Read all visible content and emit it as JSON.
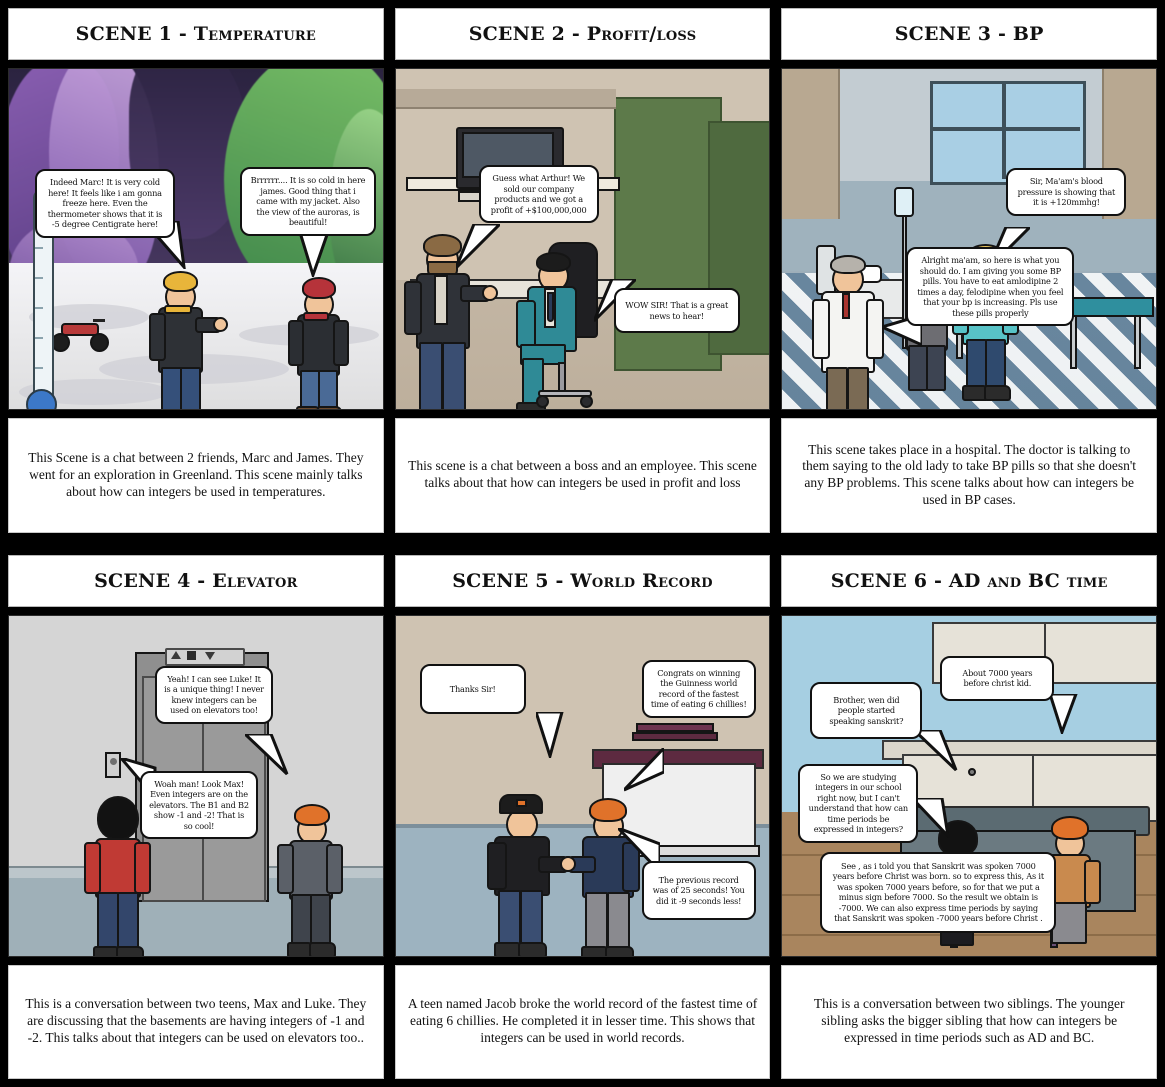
{
  "document": {
    "type": "storyboard",
    "columns": 3,
    "rows": 2,
    "panel_count": 6
  },
  "panels": [
    {
      "id": "scene-1",
      "title": "SCENE 1 - Temperature",
      "setting": "arctic-greenland-aurora",
      "bubbles": [
        {
          "id": "s1-b1",
          "speaker": "James",
          "text": "Indeed Marc! It is very cold here! It feels like i am gonna freeze here. Even the thermometer shows that it is -5 degree Centigrate here!"
        },
        {
          "id": "s1-b2",
          "speaker": "Marc",
          "text": "Brrrrrr.... It is so cold in here james. Good thing that i came with my jacket. Also the view of the auroras, is beautiful!"
        }
      ],
      "caption": "This Scene is a chat between 2 friends, Marc and James. They went for an exploration in Greenland. This scene mainly talks about how can integers be used in temperatures."
    },
    {
      "id": "scene-2",
      "title": "SCENE 2 - Profit/loss",
      "setting": "office-cubicle",
      "bubbles": [
        {
          "id": "s2-b1",
          "speaker": "Boss",
          "text": "Guess what Arthur! We sold our company products and we got a profit of +$100,000,000"
        },
        {
          "id": "s2-b2",
          "speaker": "Arthur",
          "text": "WOW SIR! That is a great news to hear!"
        }
      ],
      "caption": "This scene is a chat between a boss and an employee. This scene talks about that how can integers be used in profit and loss"
    },
    {
      "id": "scene-3",
      "title": "SCENE 3 - BP",
      "setting": "hospital-room",
      "bubbles": [
        {
          "id": "s3-b1",
          "speaker": "Nurse",
          "text": "Sir, Ma'am's blood pressure is showing that it is +120mmhg!"
        },
        {
          "id": "s3-b2",
          "speaker": "Doctor",
          "text": "Alright ma'am, so here is what you should do. I am giving you some BP pills. You have to eat amlodipine 2 times a day, felodipine when you feel that your bp is increasing. Pls use these pills properly"
        }
      ],
      "caption": "This scene takes place in a hospital. The doctor is talking to them saying to the old lady to take BP pills so that she doesn't any BP problems. This scene talks about how can integers be used in BP cases."
    },
    {
      "id": "scene-4",
      "title": "SCENE 4 - Elevator",
      "setting": "elevator-lobby",
      "bubbles": [
        {
          "id": "s4-b1",
          "speaker": "Max",
          "text": "Yeah! I can see Luke! It is a unique thing! I never knew integers can be used on elevators too!"
        },
        {
          "id": "s4-b2",
          "speaker": "Luke",
          "text": "Woah man! Look Max! Even integers are on the elevators. The B1 and B2 show -1 and -2! That is so cool!"
        }
      ],
      "caption": "This is a conversation between two teens, Max and Luke. They are discussing that the basements are having integers of -1 and -2. This talks about that integers can be used on elevators too.."
    },
    {
      "id": "scene-5",
      "title": "SCENE 5 - World Record",
      "setting": "award-podium",
      "bubbles": [
        {
          "id": "s5-b1",
          "speaker": "Jacob",
          "text": "Thanks Sir!"
        },
        {
          "id": "s5-b2",
          "speaker": "Official",
          "text": "Congrats on winning the Guinness world record of the fastest time of eating 6 chillies!"
        },
        {
          "id": "s5-b3",
          "speaker": "Official",
          "text": "The previous record was of 25 seconds! You did it -9 seconds less!"
        }
      ],
      "caption": "A teen named Jacob broke the world record of the fastest time of eating 6 chillies. He completed it in lesser time. This shows that integers can be used in world records."
    },
    {
      "id": "scene-6",
      "title": "SCENE 6 - AD and BC time",
      "setting": "kitchen-island",
      "bubbles": [
        {
          "id": "s6-b1",
          "speaker": "Younger sibling",
          "text": "Brother, wen did people started speaking sanskrit?"
        },
        {
          "id": "s6-b2",
          "speaker": "Elder sibling",
          "text": "About 7000 years before christ kid."
        },
        {
          "id": "s6-b3",
          "speaker": "Younger sibling",
          "text": "So we are studying integers in our school right now, but I can't understand that how can time periods be expressed in integers?"
        },
        {
          "id": "s6-b4",
          "speaker": "Elder sibling",
          "text": "See , as i told you that Sanskrit was spoken 7000 years before Christ was born. so to express this, As it was spoken 7000 years before, so for that we put a minus sign before 7000. So the result we obtain is -7000. We can also express time periods by saying that Sanskrit was spoken -7000 years before Christ ."
        }
      ],
      "caption": "This is a conversation between two siblings. The younger sibling asks the bigger sibling that how can integers be expressed in time periods such as AD and BC."
    }
  ],
  "colors": {
    "background": "#000000",
    "panel_border": "#2b2b2b",
    "bubble_fill": "#ffffff",
    "bubble_stroke": "#111111",
    "caption_fill": "#ffffff",
    "title_text": "#111111"
  }
}
